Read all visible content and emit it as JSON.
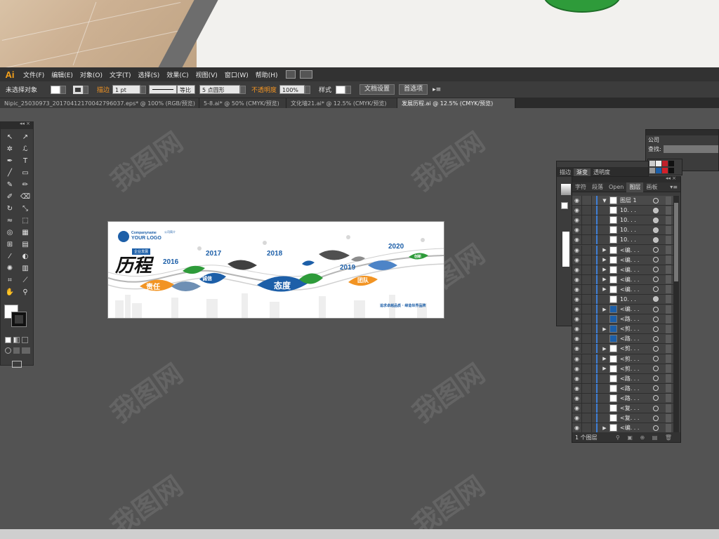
{
  "app": {
    "logo": "Ai"
  },
  "menu": [
    "文件(F)",
    "编辑(E)",
    "对象(O)",
    "文字(T)",
    "选择(S)",
    "效果(C)",
    "视图(V)",
    "窗口(W)",
    "帮助(H)"
  ],
  "control": {
    "selection": "未选择对象",
    "stroke_label": "描边",
    "stroke_value": "1 pt",
    "stroke_style": "等比",
    "brush": "5 点圆形",
    "opacity_label": "不透明度",
    "opacity_value": "100%",
    "style_label": "样式",
    "doc_setup": "文档设置",
    "prefs": "首选项"
  },
  "tabs": [
    "Nipic_25030973_20170412170042796037.eps* @ 100% (RGB/预览)",
    "5-8.ai* @ 50% (CMYK/预览)",
    "文化墙21.ai* @ 12.5% (CMYK/预览)",
    "发展历程.ai @ 12.5% (CMYK/预览)"
  ],
  "artboard": {
    "logo_line1": "Companyname",
    "logo_line2": "YOUR LOGO",
    "tag": "企业发展",
    "title": "历程",
    "years": [
      "2016",
      "2017",
      "2018",
      "2019",
      "2020"
    ],
    "leaves": [
      "责任",
      "诚信",
      "态度",
      "团队",
      "创新"
    ],
    "slogan": "追求卓越品质 · 缔造世界品牌",
    "company_intro": "公司简介"
  },
  "swatch_panel": {
    "title": "公司",
    "search_label": "查找:"
  },
  "stroke_panel": {
    "tabs": [
      "描边",
      "渐变",
      "透明度"
    ]
  },
  "layers_panel": {
    "tabs": [
      "字符",
      "段落",
      "Open",
      "图层",
      "画板"
    ],
    "active_tab": "图层",
    "rows": [
      {
        "name": "图层 1",
        "expand": "▼",
        "thumb": "light",
        "filled": false
      },
      {
        "name": "10. . .",
        "expand": "",
        "thumb": "light",
        "filled": true
      },
      {
        "name": "10. . .",
        "expand": "",
        "thumb": "light",
        "filled": true
      },
      {
        "name": "10. . .",
        "expand": "",
        "thumb": "light",
        "filled": true
      },
      {
        "name": "10. . .",
        "expand": "",
        "thumb": "light",
        "filled": true
      },
      {
        "name": "<编. . .",
        "expand": "▶",
        "thumb": "light",
        "filled": false
      },
      {
        "name": "<编. . .",
        "expand": "▶",
        "thumb": "light",
        "filled": false
      },
      {
        "name": "<编. . .",
        "expand": "▶",
        "thumb": "light",
        "filled": false
      },
      {
        "name": "<编. . .",
        "expand": "▶",
        "thumb": "light",
        "filled": false
      },
      {
        "name": "<编. . .",
        "expand": "▶",
        "thumb": "light",
        "filled": false
      },
      {
        "name": "10. . .",
        "expand": "",
        "thumb": "light",
        "filled": true
      },
      {
        "name": "<编. . .",
        "expand": "▶",
        "thumb": "dark",
        "filled": false
      },
      {
        "name": "<路. . .",
        "expand": "",
        "thumb": "dark",
        "filled": false
      },
      {
        "name": "<剪. . .",
        "expand": "▶",
        "thumb": "dark",
        "filled": false
      },
      {
        "name": "<路. . .",
        "expand": "",
        "thumb": "dark",
        "filled": false
      },
      {
        "name": "<剪. . .",
        "expand": "▶",
        "thumb": "light",
        "filled": false
      },
      {
        "name": "<剪. . .",
        "expand": "▶",
        "thumb": "light",
        "filled": false
      },
      {
        "name": "<剪. . .",
        "expand": "▶",
        "thumb": "light",
        "filled": false
      },
      {
        "name": "<路. . .",
        "expand": "",
        "thumb": "light",
        "filled": false
      },
      {
        "name": "<路. . .",
        "expand": "",
        "thumb": "light",
        "filled": false
      },
      {
        "name": "<路. . .",
        "expand": "",
        "thumb": "light",
        "filled": false
      },
      {
        "name": "<复. . .",
        "expand": "",
        "thumb": "light",
        "filled": false
      },
      {
        "name": "<复. . .",
        "expand": "",
        "thumb": "light",
        "filled": false
      },
      {
        "name": "<编. . .",
        "expand": "▶",
        "thumb": "light",
        "filled": false
      }
    ],
    "footer": "1 个图层"
  },
  "watermark": "我图网",
  "colors": {
    "blue": "#1d5fa8",
    "green": "#2e9b3a",
    "orange": "#f29423",
    "logo_orange": "#f7a21b"
  }
}
